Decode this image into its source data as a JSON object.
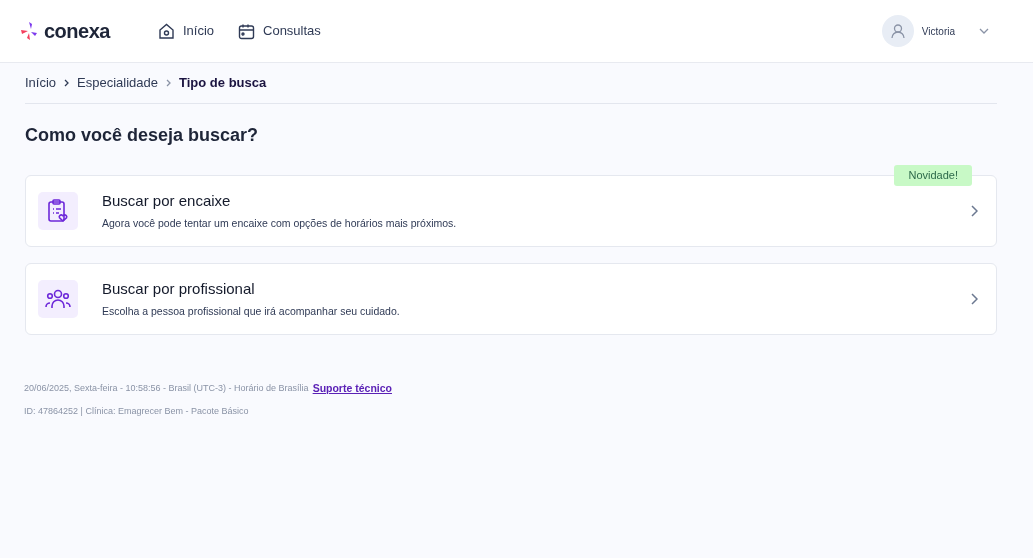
{
  "header": {
    "logo": "conexa",
    "nav": [
      {
        "label": "Início",
        "kind": "home"
      },
      {
        "label": "Consultas",
        "kind": "calendar"
      }
    ],
    "user": {
      "name": "Victoria"
    }
  },
  "breadcrumb": [
    {
      "label": "Início",
      "current": false
    },
    {
      "label": "Especialidade",
      "current": false
    },
    {
      "label": "Tipo de busca",
      "current": true
    }
  ],
  "title": "Como você deseja buscar?",
  "options": [
    {
      "kind": "clipboard",
      "title": "Buscar por encaixe",
      "description": "Agora você pode tentar um encaixe com opções de horários mais próximos.",
      "badge": "Novidade!"
    },
    {
      "kind": "people",
      "title": "Buscar por profissional",
      "description": "Escolha a pessoa profissional que irá acompanhar seu cuidado."
    }
  ],
  "footer": {
    "timestamp": "20/06/2025, Sexta-feira - 10:58:56 - Brasil (UTC-3) - Horário de Brasília",
    "support_link": "Suporte técnico",
    "info": "ID: 47864252 | Clínica: Emagrecer Bem - Pacote Básico"
  }
}
